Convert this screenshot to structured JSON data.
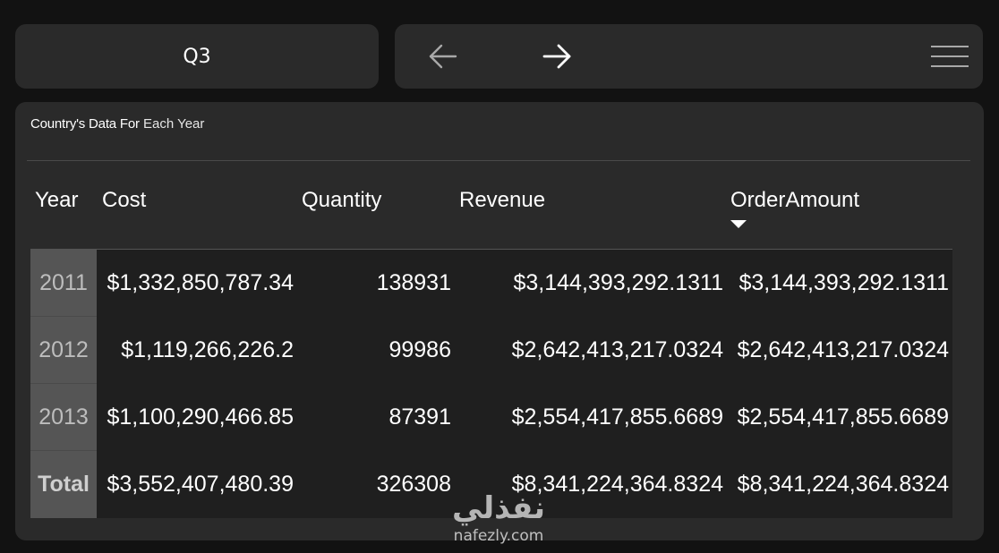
{
  "slicer": {
    "label": "Q3"
  },
  "nav": {
    "back_icon": "arrow-left-icon",
    "forward_icon": "arrow-right-icon",
    "menu_icon": "hamburger-menu-icon"
  },
  "card": {
    "title_strong": "Country's Data For",
    "title_rest": " Each Year"
  },
  "table": {
    "columns": [
      "Year",
      "Cost",
      "Quantity",
      "Revenue",
      "OrderAmount"
    ],
    "sorted_column": "OrderAmount",
    "sort_direction": "descending",
    "rows": [
      {
        "year": "2011",
        "cost": "$1,332,850,787.34",
        "quantity": "138931",
        "revenue": "$3,144,393,292.1311",
        "order_amount": "$3,144,393,292.1311"
      },
      {
        "year": "2012",
        "cost": "$1,119,266,226.2",
        "quantity": "99986",
        "revenue": "$2,642,413,217.0324",
        "order_amount": "$2,642,413,217.0324"
      },
      {
        "year": "2013",
        "cost": "$1,100,290,466.85",
        "quantity": "87391",
        "revenue": "$2,554,417,855.6689",
        "order_amount": "$2,554,417,855.6689"
      }
    ],
    "total": {
      "label": "Total",
      "cost": "$3,552,407,480.39",
      "quantity": "326308",
      "revenue": "$8,341,224,364.8324",
      "order_amount": "$8,341,224,364.8324"
    }
  },
  "watermark": {
    "arabic": "نفذلي",
    "url": "nafezly.com"
  },
  "colors": {
    "background": "#121212",
    "card": "#2a2a2a",
    "row": "#1f1f1f",
    "year_cell": "#555555",
    "text": "#ffffff"
  }
}
